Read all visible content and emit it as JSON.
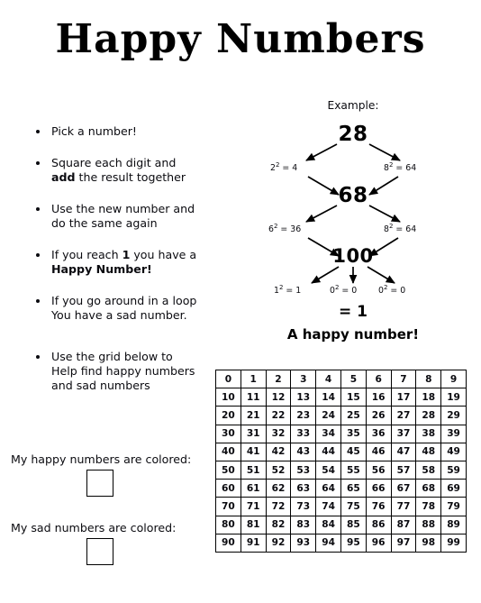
{
  "title": "Happy Numbers",
  "steps": [
    {
      "id": "step-pick",
      "html": "Pick a number!"
    },
    {
      "id": "step-square",
      "html": "Square each digit and<br><b>add</b> the result together"
    },
    {
      "id": "step-repeat",
      "html": "Use the new number and<br>do the same again"
    },
    {
      "id": "step-happy",
      "html": "If you reach <b>1</b> you have a<br><b>Happy Number!</b>"
    },
    {
      "id": "step-sad",
      "html": "If you go around in a loop<br>You have a sad number."
    },
    {
      "id": "step-grid",
      "html": "Use the grid below to<br>Help find happy numbers<br>and sad numbers"
    }
  ],
  "color_key": {
    "happy_label": "My happy numbers are colored:",
    "sad_label": "My sad numbers are colored:",
    "happy_swatch_color": "#ffffff",
    "sad_swatch_color": "#ffffff"
  },
  "example": {
    "label": "Example:",
    "node_1": "28",
    "node_2": "68",
    "node_3": "100",
    "calc_2_squared": "2² = 4",
    "calc_8_squared": "8² = 64",
    "calc_6_squared": "6² = 36",
    "calc_8_squared_2": "8² = 64",
    "calc_1_squared": "1² = 1",
    "calc_0_squared_a": "0² = 0",
    "calc_0_squared_b": "0² = 0",
    "result_equals": "= 1",
    "result_message": "A happy number!"
  },
  "grid": {
    "rows": [
      [
        "0",
        "1",
        "2",
        "3",
        "4",
        "5",
        "6",
        "7",
        "8",
        "9"
      ],
      [
        "10",
        "11",
        "12",
        "13",
        "14",
        "15",
        "16",
        "17",
        "18",
        "19"
      ],
      [
        "20",
        "21",
        "22",
        "23",
        "24",
        "25",
        "26",
        "27",
        "28",
        "29"
      ],
      [
        "30",
        "31",
        "32",
        "33",
        "34",
        "35",
        "36",
        "37",
        "38",
        "39"
      ],
      [
        "40",
        "41",
        "42",
        "43",
        "44",
        "45",
        "46",
        "47",
        "48",
        "49"
      ],
      [
        "50",
        "51",
        "52",
        "53",
        "54",
        "55",
        "56",
        "57",
        "58",
        "59"
      ],
      [
        "60",
        "61",
        "62",
        "63",
        "64",
        "65",
        "66",
        "67",
        "68",
        "69"
      ],
      [
        "70",
        "71",
        "72",
        "73",
        "74",
        "75",
        "76",
        "77",
        "78",
        "79"
      ],
      [
        "80",
        "81",
        "82",
        "83",
        "84",
        "85",
        "86",
        "87",
        "88",
        "89"
      ],
      [
        "90",
        "91",
        "92",
        "93",
        "94",
        "95",
        "96",
        "97",
        "98",
        "99"
      ]
    ]
  }
}
